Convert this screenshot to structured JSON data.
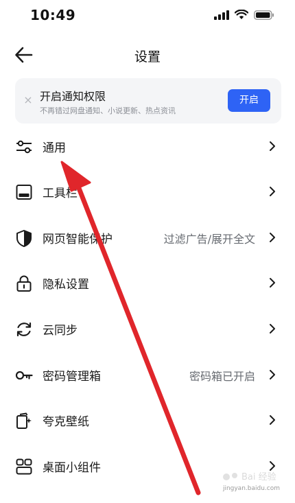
{
  "status_bar": {
    "time": "10:49"
  },
  "header": {
    "title": "设置",
    "back_icon": "arrow-left-icon"
  },
  "notice": {
    "title": "开启通知权限",
    "subtitle": "不再错过网盘通知、小说更新、热点资讯",
    "button_label": "开启",
    "close_glyph": "×",
    "accent_color": "#2e63f5"
  },
  "settings": [
    {
      "label": "通用",
      "value": "",
      "icon": "sliders-icon"
    },
    {
      "label": "工具栏",
      "value": "",
      "icon": "toolbar-icon"
    },
    {
      "label": "网页智能保护",
      "value": "过滤广告/展开全文",
      "icon": "shield-icon"
    },
    {
      "label": "隐私设置",
      "value": "",
      "icon": "lock-icon"
    },
    {
      "label": "云同步",
      "value": "",
      "icon": "sync-icon"
    },
    {
      "label": "密码管理箱",
      "value": "密码箱已开启",
      "icon": "key-icon"
    },
    {
      "label": "夸克壁纸",
      "value": "",
      "icon": "wallpaper-icon"
    },
    {
      "label": "桌面小组件",
      "value": "",
      "icon": "widgets-icon"
    }
  ],
  "annotation": {
    "arrow_color": "#e0262b"
  },
  "watermark": {
    "text": "jingyan.baidu.com"
  }
}
